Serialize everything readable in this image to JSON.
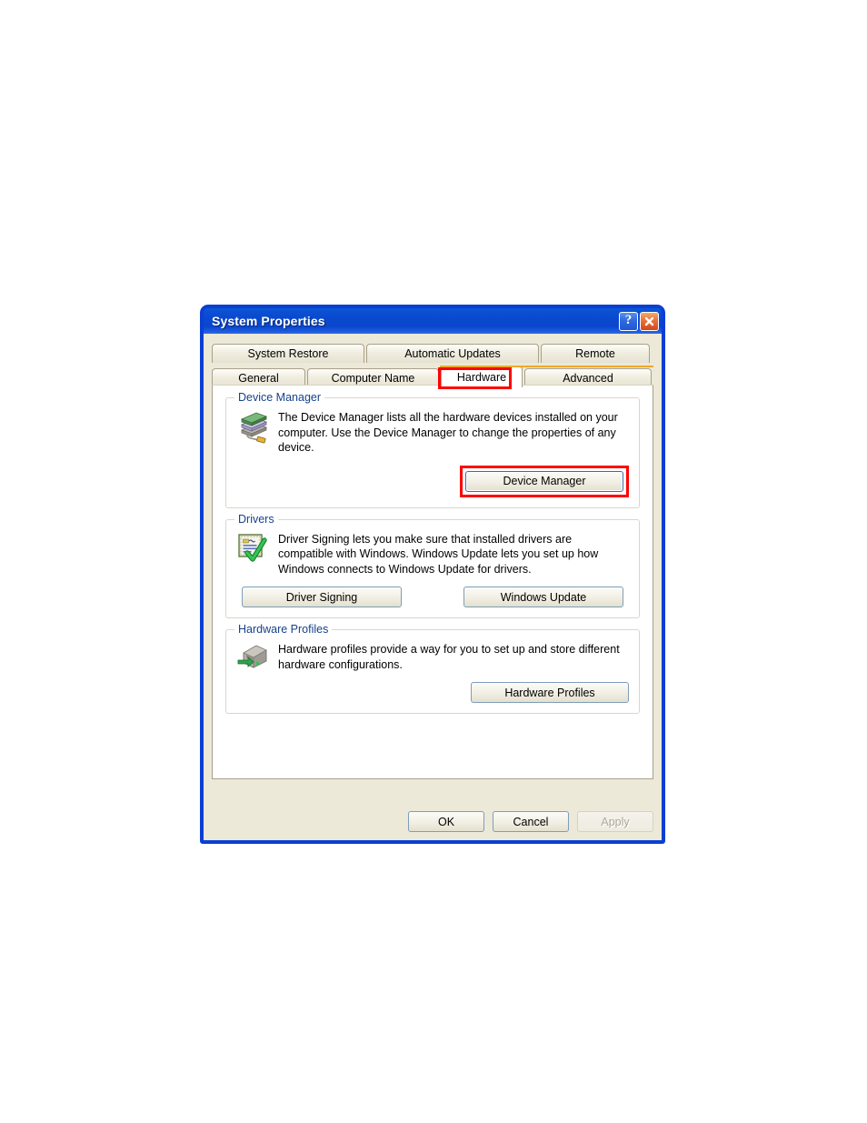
{
  "window": {
    "title": "System Properties",
    "titlebar_buttons": [
      {
        "name": "help-button",
        "label": "?"
      },
      {
        "name": "close-button",
        "label": "✕"
      }
    ]
  },
  "tabs": {
    "row1": [
      {
        "label": "System Restore",
        "selected": false
      },
      {
        "label": "Automatic Updates",
        "selected": false
      },
      {
        "label": "Remote",
        "selected": false
      }
    ],
    "row2": [
      {
        "label": "General",
        "selected": false
      },
      {
        "label": "Computer Name",
        "selected": false
      },
      {
        "label": "Hardware",
        "selected": true
      },
      {
        "label": "Advanced",
        "selected": false
      }
    ],
    "selected_label": "Hardware",
    "highlight_color": "#ff0000",
    "selected_accent_color": "#f0a828"
  },
  "groups": {
    "device_manager": {
      "legend": "Device Manager",
      "icon": "device-stack-icon",
      "description": "The Device Manager lists all the hardware devices installed on your computer. Use the Device Manager to change the properties of any device.",
      "button": "Device Manager",
      "button_highlighted": true
    },
    "drivers": {
      "legend": "Drivers",
      "icon": "driver-signing-certificate-icon",
      "description": "Driver Signing lets you make sure that installed drivers are compatible with Windows. Windows Update lets you set up how Windows connects to Windows Update for drivers.",
      "button_left": "Driver Signing",
      "button_right": "Windows Update"
    },
    "hardware_profiles": {
      "legend": "Hardware Profiles",
      "icon": "hardware-profile-computer-icon",
      "description": "Hardware profiles provide a way for you to set up and store different hardware configurations.",
      "button": "Hardware Profiles"
    }
  },
  "footer": {
    "ok": "OK",
    "cancel": "Cancel",
    "apply": "Apply",
    "apply_disabled": true
  },
  "colors": {
    "titlebar_blue": "#0b46ce",
    "window_border": "#0b3fd4",
    "dialog_face": "#ece9d8",
    "legend_blue": "#15428b",
    "highlight_red": "#ff0000",
    "tab_accent_orange": "#f0a828",
    "button_border_blue": "#7f9db9"
  }
}
